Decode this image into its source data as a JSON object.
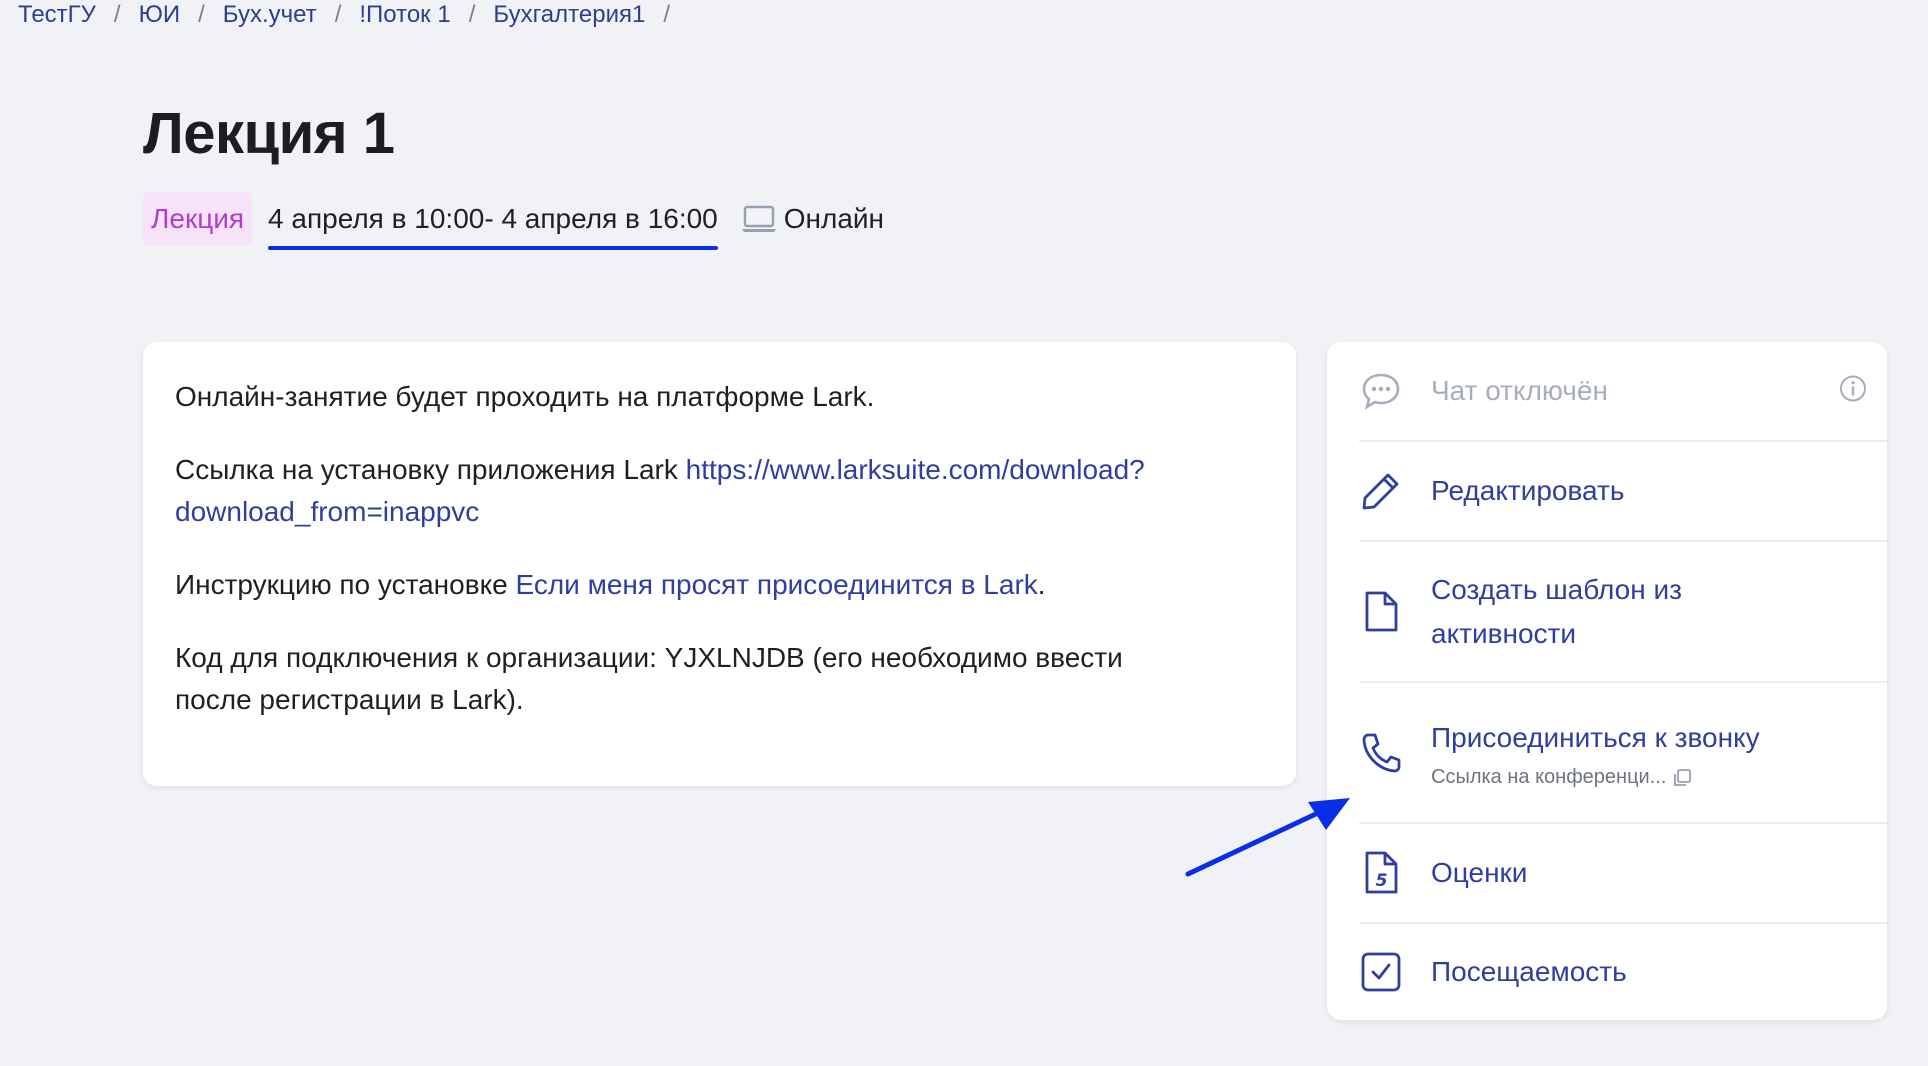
{
  "breadcrumb": [
    "ТестГУ",
    "ЮИ",
    "Бух.учет",
    "!Поток 1",
    "Бухгалтерия1"
  ],
  "breadcrumb_separator": "/",
  "page": {
    "title": "Лекция 1",
    "type_badge": "Лекция",
    "date_range": "4 апреля в 10:00- 4 апреля в 16:00",
    "format": "Онлайн"
  },
  "content": {
    "line1": "Онлайн-занятие будет проходить на платформе Lark.",
    "line2_prefix": "Ссылка на установку приложения Lark ",
    "line2_link_a": "https://www.larksuite.com/download?",
    "line2_link_b": "download_from=inappvc",
    "line3_prefix": "Инструкцию по установке ",
    "line3_link": "Если меня просят присоединится в Lark",
    "line3_suffix": ".",
    "line4": "Код для подключения к организации: YJXLNJDB (его необходимо ввести",
    "line5": "после регистрации в Lark)."
  },
  "panel": {
    "chat": "Чат отключён",
    "edit": "Редактировать",
    "template_line1": "Создать шаблон из",
    "template_line2": "активности",
    "join_call": "Присоединиться к звонку",
    "conference_link": "Ссылка на конференци...",
    "grades": "Оценки",
    "attendance": "Посещаемость"
  },
  "colors": {
    "accent": "#2f3ea0",
    "badge_bg": "#f6e3f8",
    "badge_text": "#b23ad6",
    "annotation": "#0a2ee8",
    "background": "#f0f2f6"
  }
}
